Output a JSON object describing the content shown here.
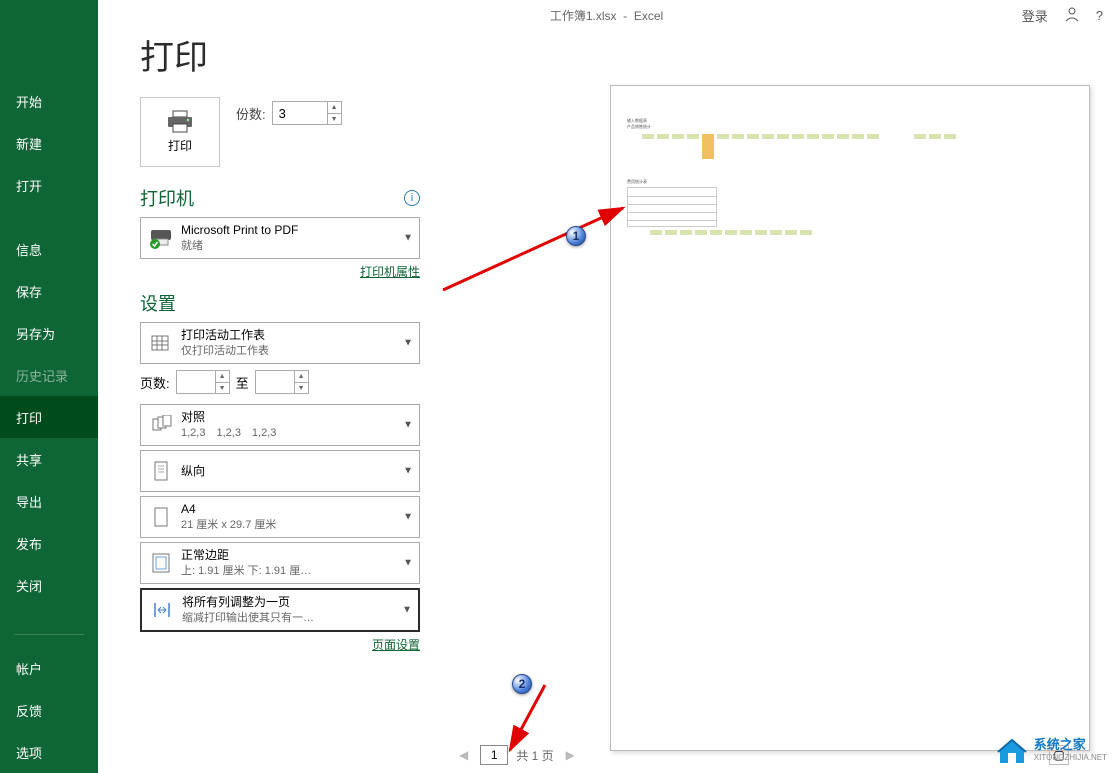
{
  "titlebar": {
    "filename": "工作簿1.xlsx",
    "appname": "Excel",
    "login": "登录",
    "help": "?"
  },
  "sidebar": {
    "items": [
      {
        "label": "开始"
      },
      {
        "label": "新建"
      },
      {
        "label": "打开"
      },
      {
        "label": "信息"
      },
      {
        "label": "保存"
      },
      {
        "label": "另存为"
      },
      {
        "label": "历史记录",
        "disabled": true
      },
      {
        "label": "打印",
        "active": true
      },
      {
        "label": "共享"
      },
      {
        "label": "导出"
      },
      {
        "label": "发布"
      },
      {
        "label": "关闭"
      }
    ],
    "footer": [
      {
        "label": "帐户"
      },
      {
        "label": "反馈"
      },
      {
        "label": "选项"
      }
    ]
  },
  "page": {
    "title": "打印"
  },
  "print_button": {
    "label": "打印"
  },
  "copies": {
    "label": "份数:",
    "value": "3"
  },
  "printer": {
    "title": "打印机",
    "name": "Microsoft Print to PDF",
    "status": "就绪",
    "properties": "打印机属性"
  },
  "settings": {
    "title": "设置",
    "option1": {
      "line1": "打印活动工作表",
      "line2": "仅打印活动工作表"
    },
    "pages": {
      "label": "页数:",
      "to": "至"
    },
    "option2": {
      "line1": "对照",
      "line2": "1,2,3　1,2,3　1,2,3"
    },
    "option3": {
      "line1": "纵向",
      "line2": ""
    },
    "option4": {
      "line1": "A4",
      "line2": "21 厘米 x 29.7 厘米"
    },
    "option5": {
      "line1": "正常边距",
      "line2": "上: 1.91 厘米 下: 1.91 厘…"
    },
    "option6": {
      "line1": "将所有列调整为一页",
      "line2": "缩减打印输出使其只有一…"
    },
    "page_setup": "页面设置"
  },
  "pager": {
    "page": "1",
    "total_label": "共 1 页"
  },
  "callouts": {
    "c1": "1",
    "c2": "2"
  },
  "watermark": {
    "name": "系统之家",
    "domain": "XITONGZHIJIA.NET"
  }
}
